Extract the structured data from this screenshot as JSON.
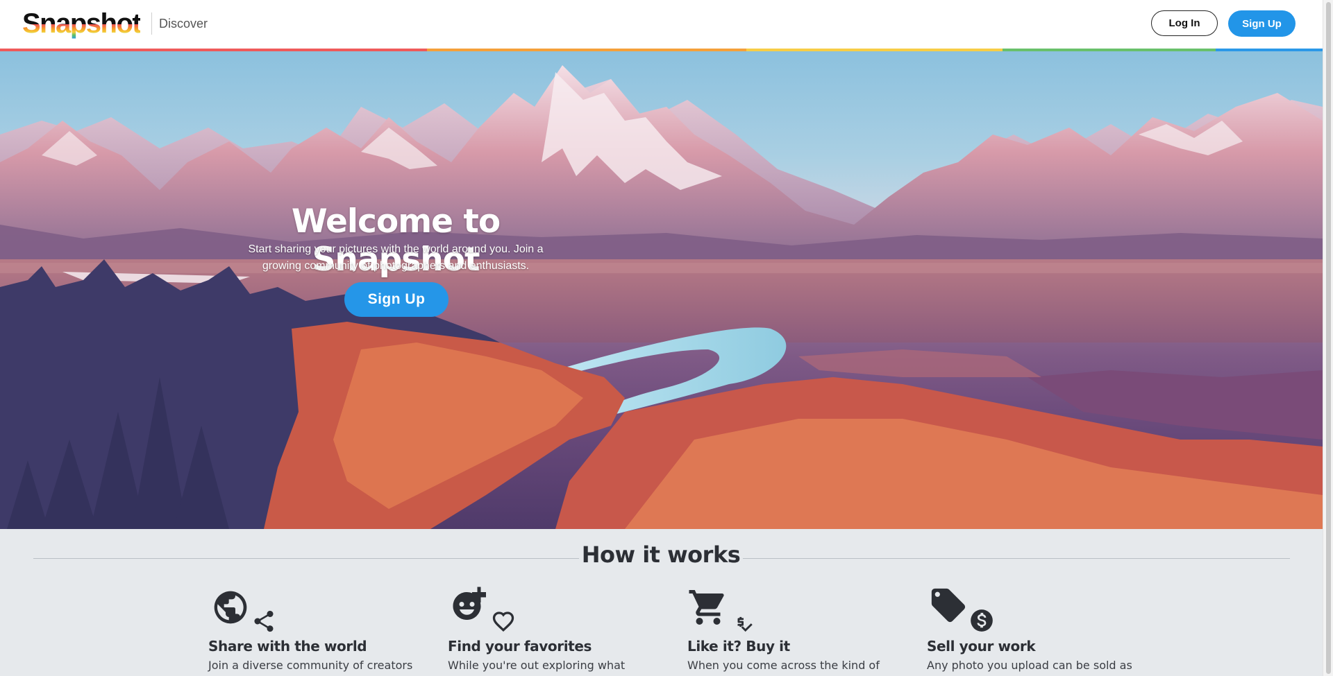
{
  "header": {
    "logo_text": "Snapshot",
    "nav_discover": "Discover",
    "login_label": "Log In",
    "signup_label": "Sign Up"
  },
  "colors": {
    "accent_blue": "#2295e8",
    "rainbow": [
      "#ef5a5a",
      "#f5a03a",
      "#f7cd46",
      "#69c06b",
      "#2b98e8"
    ]
  },
  "hero": {
    "title": "Welcome to Snapshot",
    "subtitle": "Start sharing your pictures with the world around you. Join a growing community of photographers and enthusiasts.",
    "cta_label": "Sign Up"
  },
  "how_it_works": {
    "title": "How it works",
    "features": [
      {
        "title": "Share with the world",
        "text": "Join a diverse community of creators",
        "icons": [
          "globe-icon",
          "share-icon"
        ]
      },
      {
        "title": "Find your favorites",
        "text": "While you're out exploring what",
        "icons": [
          "add-emoji-icon",
          "heart-icon"
        ]
      },
      {
        "title": "Like it? Buy it",
        "text": "When you come across the kind of",
        "icons": [
          "cart-icon",
          "price-check-icon"
        ]
      },
      {
        "title": "Sell your work",
        "text": "Any photo you upload can be sold as",
        "icons": [
          "tag-icon",
          "dollar-coin-icon"
        ]
      }
    ]
  }
}
